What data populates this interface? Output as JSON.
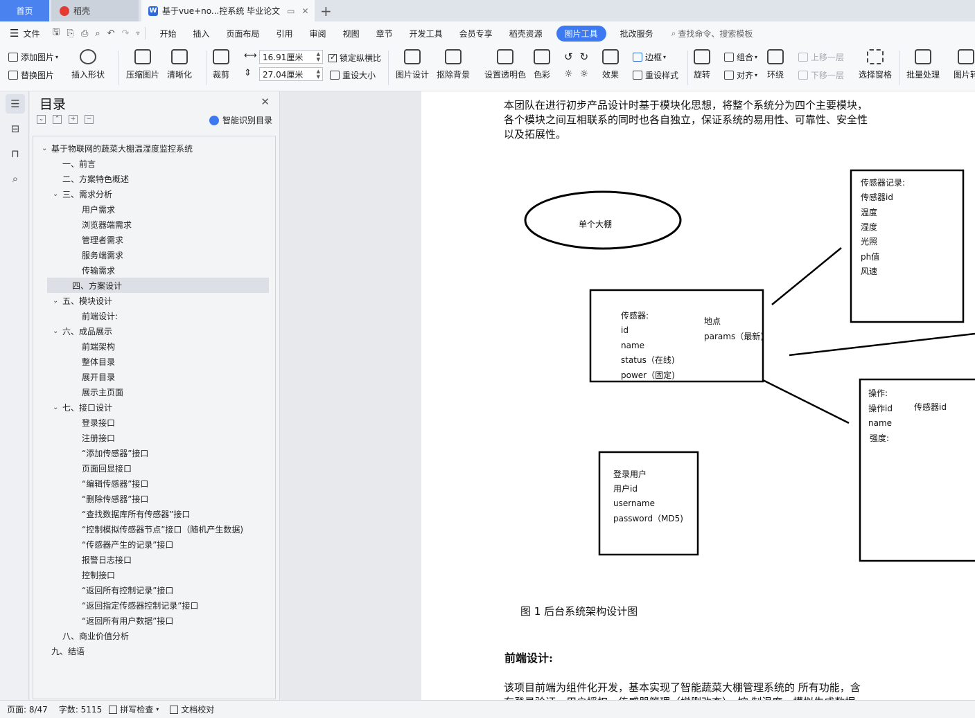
{
  "tabs": {
    "home": "首页",
    "daoke": "稻壳",
    "doc": "基于vue+no...控系统 毕业论文"
  },
  "menubar": {
    "file": "文件",
    "items": [
      "开始",
      "插入",
      "页面布局",
      "引用",
      "审阅",
      "视图",
      "章节",
      "开发工具",
      "会员专享",
      "稻壳资源"
    ],
    "active": "图片工具",
    "after": "批改服务",
    "search": "查找命令、搜索模板"
  },
  "ribbon": {
    "add_image": "添加图片",
    "replace_image": "替换图片",
    "insert_shape": "插入形状",
    "compress": "压缩图片",
    "clarity": "清晰化",
    "crop": "裁剪",
    "width_value": "16.91厘米",
    "height_value": "27.04厘米",
    "lock_ratio": "锁定纵横比",
    "reset_size": "重设大小",
    "image_design": "图片设计",
    "remove_bg": "抠除背景",
    "set_transparent": "设置透明色",
    "color": "色彩",
    "effect": "效果",
    "border": "边框",
    "reset_style": "重设样式",
    "rotate": "旋转",
    "group": "组合",
    "align": "对齐",
    "wrap": "环绕",
    "bring_forward": "上移一层",
    "send_backward": "下移一层",
    "selection_pane": "选择窗格",
    "batch": "批量处理",
    "image_more": "图片转"
  },
  "toc": {
    "title": "目录",
    "ai_label": "智能识别目录",
    "items": [
      {
        "label": "基于物联网的蔬菜大棚温湿度监控系统",
        "level": 0,
        "expanded": true
      },
      {
        "label": "一、前言",
        "level": 1
      },
      {
        "label": "二、方案特色概述",
        "level": 1
      },
      {
        "label": "三、需求分析",
        "level": 1,
        "expanded": true
      },
      {
        "label": "用户需求",
        "level": 2
      },
      {
        "label": "浏览器端需求",
        "level": 2
      },
      {
        "label": "管理者需求",
        "level": 2
      },
      {
        "label": "服务端需求",
        "level": 2
      },
      {
        "label": "传输需求",
        "level": 2
      },
      {
        "label": "四、方案设计",
        "level": 1,
        "selected": true
      },
      {
        "label": "五、模块设计",
        "level": 1,
        "expanded": true
      },
      {
        "label": "前端设计:",
        "level": 2
      },
      {
        "label": "六、成品展示",
        "level": 1,
        "expanded": true
      },
      {
        "label": "前端架构",
        "level": 2
      },
      {
        "label": "整体目录",
        "level": 2
      },
      {
        "label": "展开目录",
        "level": 2
      },
      {
        "label": "展示主页面",
        "level": 2
      },
      {
        "label": "七、接口设计",
        "level": 1,
        "expanded": true
      },
      {
        "label": "登录接口",
        "level": 2
      },
      {
        "label": "注册接口",
        "level": 2
      },
      {
        "label": "“添加传感器”接口",
        "level": 2
      },
      {
        "label": "页面回显接口",
        "level": 2
      },
      {
        "label": "“编辑传感器”接口",
        "level": 2
      },
      {
        "label": "“删除传感器”接口",
        "level": 2
      },
      {
        "label": "“查找数据库所有传感器”接口",
        "level": 2
      },
      {
        "label": "“控制模拟传感器节点”接口（随机产生数据)",
        "level": 2
      },
      {
        "label": "“传感器产生的记录”接口",
        "level": 2
      },
      {
        "label": "报警日志接口",
        "level": 2
      },
      {
        "label": "控制接口",
        "level": 2
      },
      {
        "label": "“返回所有控制记录”接口",
        "level": 2
      },
      {
        "label": "“返回指定传感器控制记录”接口",
        "level": 2
      },
      {
        "label": "“返回所有用户数据”接口",
        "level": 2
      },
      {
        "label": "八、商业价值分析",
        "level": 1
      },
      {
        "label": "九、结语",
        "level": 0
      }
    ]
  },
  "document": {
    "intro_lines": [
      "本团队在进行初步产品设计时基于模块化思想，将整个系统分为四个主要模块，",
      "各个模块之间互相联系的同时也各自独立，保证系统的易用性、可靠性、安全性",
      "以及拓展性。"
    ],
    "diagram": {
      "ellipse": "单个大棚",
      "sensor_lines": [
        "传感器:",
        "id",
        "name",
        "status（在线)",
        "power（固定)"
      ],
      "sensor_right": [
        "地点",
        "params（最新)"
      ],
      "record_lines": [
        "传感器记录:",
        "传感器id",
        "温度",
        "湿度",
        "光照",
        "ph值",
        "风速"
      ],
      "op_lines": [
        "操作:",
        "操作id",
        "name",
        "强度:"
      ],
      "op_right": "传感器id",
      "user_lines": [
        "登录用户",
        "用户id",
        "username",
        "password（MD5)"
      ]
    },
    "caption": "图 1 后台系统架构设计图",
    "heading": "前端设计:",
    "tail_line": "该项目前端为组件化开发，基本实现了智能蔬菜大棚管理系统的 所有功能，含",
    "tail_line_cut": "有登录验证，用户授权，传感器管理（增删改查），控 制温度，模拟生成数据"
  },
  "status": {
    "page": "页面: 8/47",
    "words": "字数: 5115",
    "spell": "拼写检查",
    "proof": "文档校对"
  }
}
